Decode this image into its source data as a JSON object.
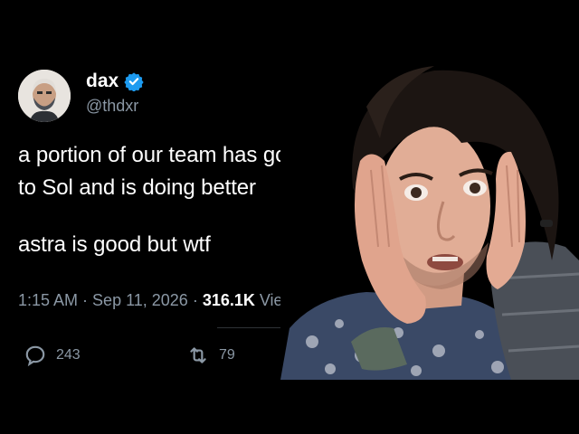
{
  "tweet": {
    "author": {
      "name": "dax",
      "handle": "@thdxr",
      "verified": true,
      "avatar": "avatar-illustration"
    },
    "lines": [
      "a portion of our team has gone back to Sol and is doing better",
      "astra is good but wtf"
    ],
    "meta": {
      "time": "1:15 AM",
      "separator1": " · ",
      "date": "Sep 11, 2026",
      "separator2": " · ",
      "views_count": "316.1K",
      "views_label": " Views"
    },
    "actions": {
      "reply_icon": "speech-bubble-icon",
      "reply_count": "243",
      "retweet_icon": "retweet-icon",
      "retweet_count": "79"
    }
  },
  "colors": {
    "background": "#000000",
    "text": "#ffffff",
    "muted": "#8b98a5",
    "verified_blue": "#1d9bf0"
  },
  "photo": {
    "subject": "person-hands-on-face-shocked"
  }
}
